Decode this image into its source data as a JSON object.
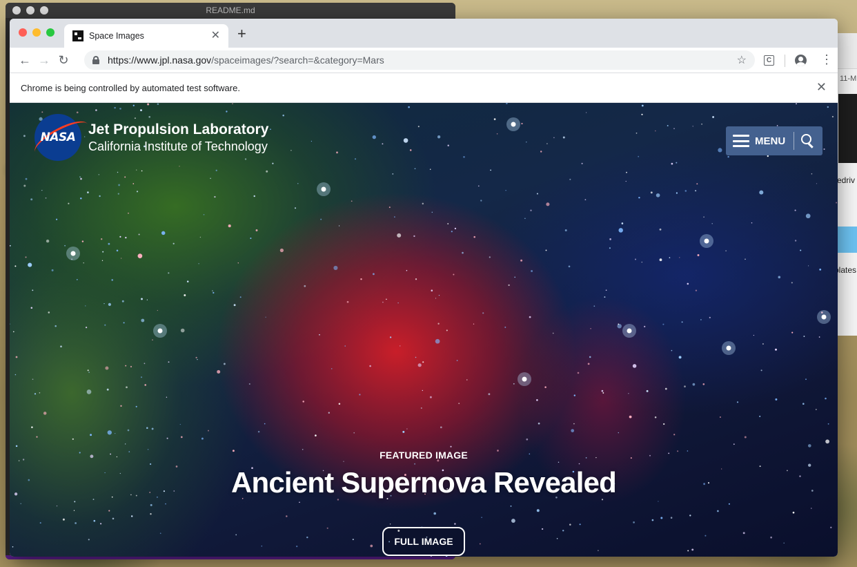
{
  "background_window": {
    "title": "README.md"
  },
  "right_window": {
    "tag": "11-M",
    "text1": "edriv",
    "text2": "plates"
  },
  "browser": {
    "tab_title": "Space Images",
    "new_tab_label": "+",
    "url_host": "https://www.jpl.nasa.gov",
    "url_path": "/spaceimages/?search=&category=Mars",
    "extension_label": "C",
    "infobar_text": "Chrome is being controlled by automated test software."
  },
  "page": {
    "org_name": "Jet Propulsion Laboratory",
    "org_sub": "California Institute of Technology",
    "nasa_logo_text": "NASA",
    "menu_label": "MENU",
    "featured_kicker": "FEATURED IMAGE",
    "featured_title": "Ancient Supernova Revealed",
    "full_image_label": "FULL IMAGE"
  },
  "colors": {
    "menu_button": "#44618f",
    "tabstrip": "#dee1e6",
    "nasa_blue": "#0b3d91",
    "nasa_red": "#fc3d21"
  },
  "icons": {
    "back": "arrow-left-icon",
    "forward": "arrow-right-icon",
    "reload": "reload-icon",
    "lock": "lock-icon",
    "bookmark": "star-icon",
    "profile": "profile-icon",
    "more": "kebab-icon",
    "close": "close-icon",
    "menu": "hamburger-icon",
    "search": "search-icon"
  }
}
